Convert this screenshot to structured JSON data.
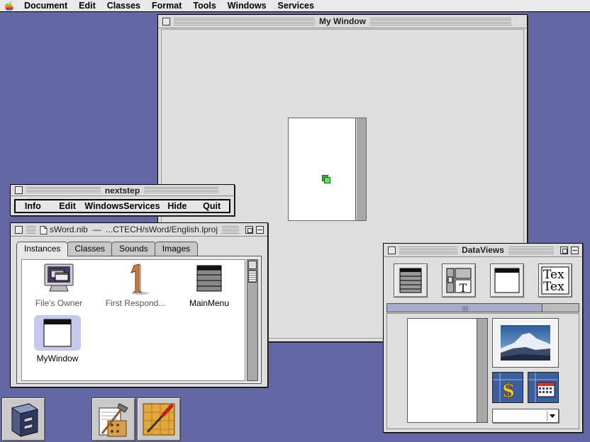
{
  "menubar": {
    "apple_icon": "apple-icon",
    "items": [
      "Document",
      "Edit",
      "Classes",
      "Format",
      "Tools",
      "Windows",
      "Services"
    ]
  },
  "my_window": {
    "title": "My Window"
  },
  "nextstep_panel": {
    "title": "nextstep",
    "items": [
      "Info",
      "Edit",
      "Windows",
      "Services",
      "Hide",
      "Quit"
    ]
  },
  "nib_window": {
    "title": "sWord.nib  —  ...CTECH/sWord/English.lproj",
    "tabs": [
      "Instances",
      "Classes",
      "Sounds",
      "Images"
    ],
    "active_tab": "Instances",
    "items": [
      {
        "label": "File's Owner",
        "icon": "monitor-icon"
      },
      {
        "label": "First Respond...",
        "icon": "number-one-icon"
      },
      {
        "label": "MainMenu",
        "icon": "menu-icon"
      },
      {
        "label": "MyWindow",
        "icon": "window-icon"
      }
    ]
  },
  "dataviews": {
    "title": "DataViews",
    "palette_items": [
      "tableview-icon",
      "browser-icon",
      "scrollview-icon",
      "textview-icon"
    ],
    "textview_sample": "Tex",
    "format_items": [
      "currency-formatter-icon",
      "date-formatter-icon"
    ],
    "currency_symbol": "$"
  },
  "dock": {
    "items": [
      "file-viewer-icon",
      "project-builder-icon",
      "interface-builder-icon"
    ]
  },
  "colors": {
    "desktop": "#6467a6",
    "selection": "#c6c8ee",
    "formatter_blue": "#3a5ea0"
  }
}
